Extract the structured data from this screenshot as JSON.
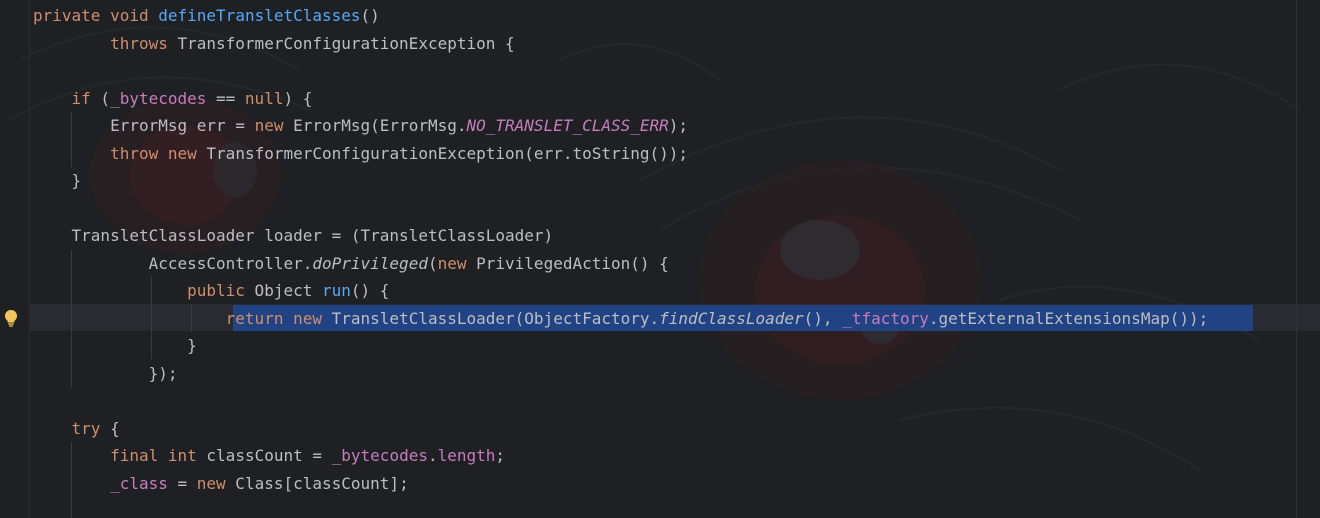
{
  "editor": {
    "theme_colors": {
      "background": "#1f2024",
      "keyword": "#cf8e6d",
      "method_declaration": "#56a8f5",
      "field": "#c77dbb",
      "default_text": "#bcbec4",
      "selection": "#214283"
    },
    "gutter": {
      "lightbulb_icon": "lightbulb-icon"
    },
    "lines": [
      [
        {
          "t": "private",
          "c": "kw"
        },
        {
          "t": " "
        },
        {
          "t": "void",
          "c": "kw"
        },
        {
          "t": " "
        },
        {
          "t": "defineTransletClasses",
          "c": "fn"
        },
        {
          "t": "()"
        }
      ],
      [
        {
          "t": "        "
        },
        {
          "t": "throws",
          "c": "kw"
        },
        {
          "t": " TransformerConfigurationException {"
        }
      ],
      [
        {
          "t": ""
        }
      ],
      [
        {
          "t": "    "
        },
        {
          "t": "if",
          "c": "kw"
        },
        {
          "t": " ("
        },
        {
          "t": "_bytecodes",
          "c": "fld"
        },
        {
          "t": " == "
        },
        {
          "t": "null",
          "c": "kw"
        },
        {
          "t": ") {"
        }
      ],
      [
        {
          "t": "        ErrorMsg err = "
        },
        {
          "t": "new",
          "c": "kw"
        },
        {
          "t": " ErrorMsg(ErrorMsg."
        },
        {
          "t": "NO_TRANSLET_CLASS_ERR",
          "c": "sfld"
        },
        {
          "t": ");"
        }
      ],
      [
        {
          "t": "        "
        },
        {
          "t": "throw",
          "c": "kw"
        },
        {
          "t": " "
        },
        {
          "t": "new",
          "c": "kw"
        },
        {
          "t": " TransformerConfigurationException(err.toString());"
        }
      ],
      [
        {
          "t": "    }"
        }
      ],
      [
        {
          "t": ""
        }
      ],
      [
        {
          "t": "    TransletClassLoader loader = (TransletClassLoader)"
        }
      ],
      [
        {
          "t": "            AccessController."
        },
        {
          "t": "doPrivileged",
          "c": "sm"
        },
        {
          "t": "("
        },
        {
          "t": "new",
          "c": "kw"
        },
        {
          "t": " PrivilegedAction() {"
        }
      ],
      [
        {
          "t": "                "
        },
        {
          "t": "public",
          "c": "kw"
        },
        {
          "t": " Object "
        },
        {
          "t": "run",
          "c": "fn"
        },
        {
          "t": "() {"
        }
      ],
      [
        {
          "t": "                    "
        },
        {
          "t": "return",
          "c": "kw"
        },
        {
          "t": " "
        },
        {
          "t": "new",
          "c": "kw"
        },
        {
          "t": " TransletClassLoader(ObjectFactory."
        },
        {
          "t": "findClassLoader",
          "c": "sm"
        },
        {
          "t": "(), "
        },
        {
          "t": "_tfactory",
          "c": "fld"
        },
        {
          "t": ".getExternalExtensionsMap());"
        }
      ],
      [
        {
          "t": "                }"
        }
      ],
      [
        {
          "t": "            });"
        }
      ],
      [
        {
          "t": ""
        }
      ],
      [
        {
          "t": "    "
        },
        {
          "t": "try",
          "c": "kw"
        },
        {
          "t": " {"
        }
      ],
      [
        {
          "t": "        "
        },
        {
          "t": "final",
          "c": "kw"
        },
        {
          "t": " "
        },
        {
          "t": "int",
          "c": "kw"
        },
        {
          "t": " classCount = "
        },
        {
          "t": "_bytecodes",
          "c": "fld"
        },
        {
          "t": "."
        },
        {
          "t": "length",
          "c": "fld"
        },
        {
          "t": ";"
        }
      ],
      [
        {
          "t": "        "
        },
        {
          "t": "_class",
          "c": "fld"
        },
        {
          "t": " = "
        },
        {
          "t": "new",
          "c": "kw"
        },
        {
          "t": " Class[classCount];"
        }
      ]
    ]
  }
}
